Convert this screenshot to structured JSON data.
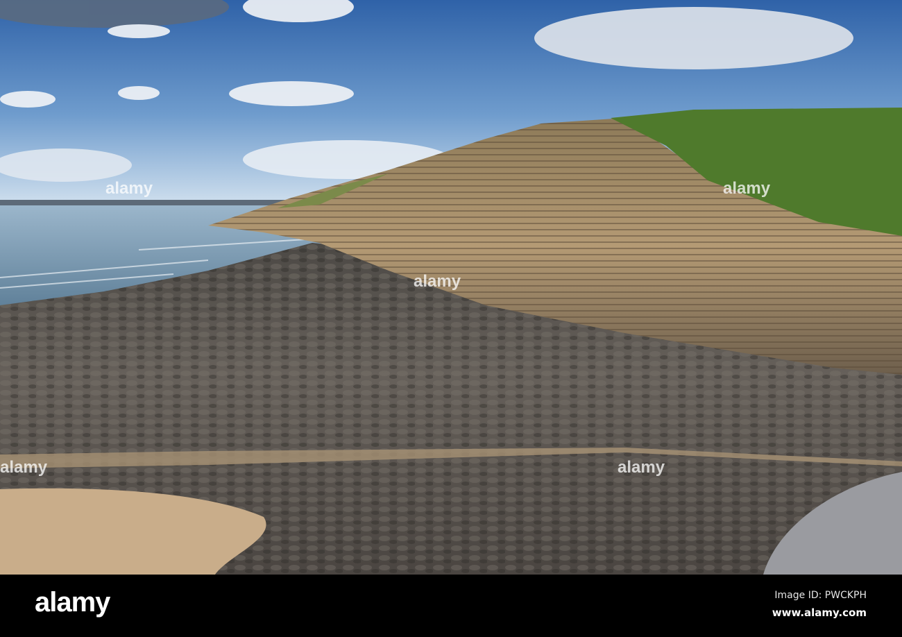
{
  "watermark": {
    "logo": "alamy",
    "image_id": "Image ID: PWCKPH",
    "site": "www.alamy.com"
  },
  "colors": {
    "sky_top": "#3b6eb2",
    "sky_horizon": "#cfe0ef",
    "sea": "#7f9fb8",
    "cliff": "#a08866",
    "grass": "#4f7a2c",
    "rocks": "#5a5450",
    "sand": "#c9ad8a"
  }
}
